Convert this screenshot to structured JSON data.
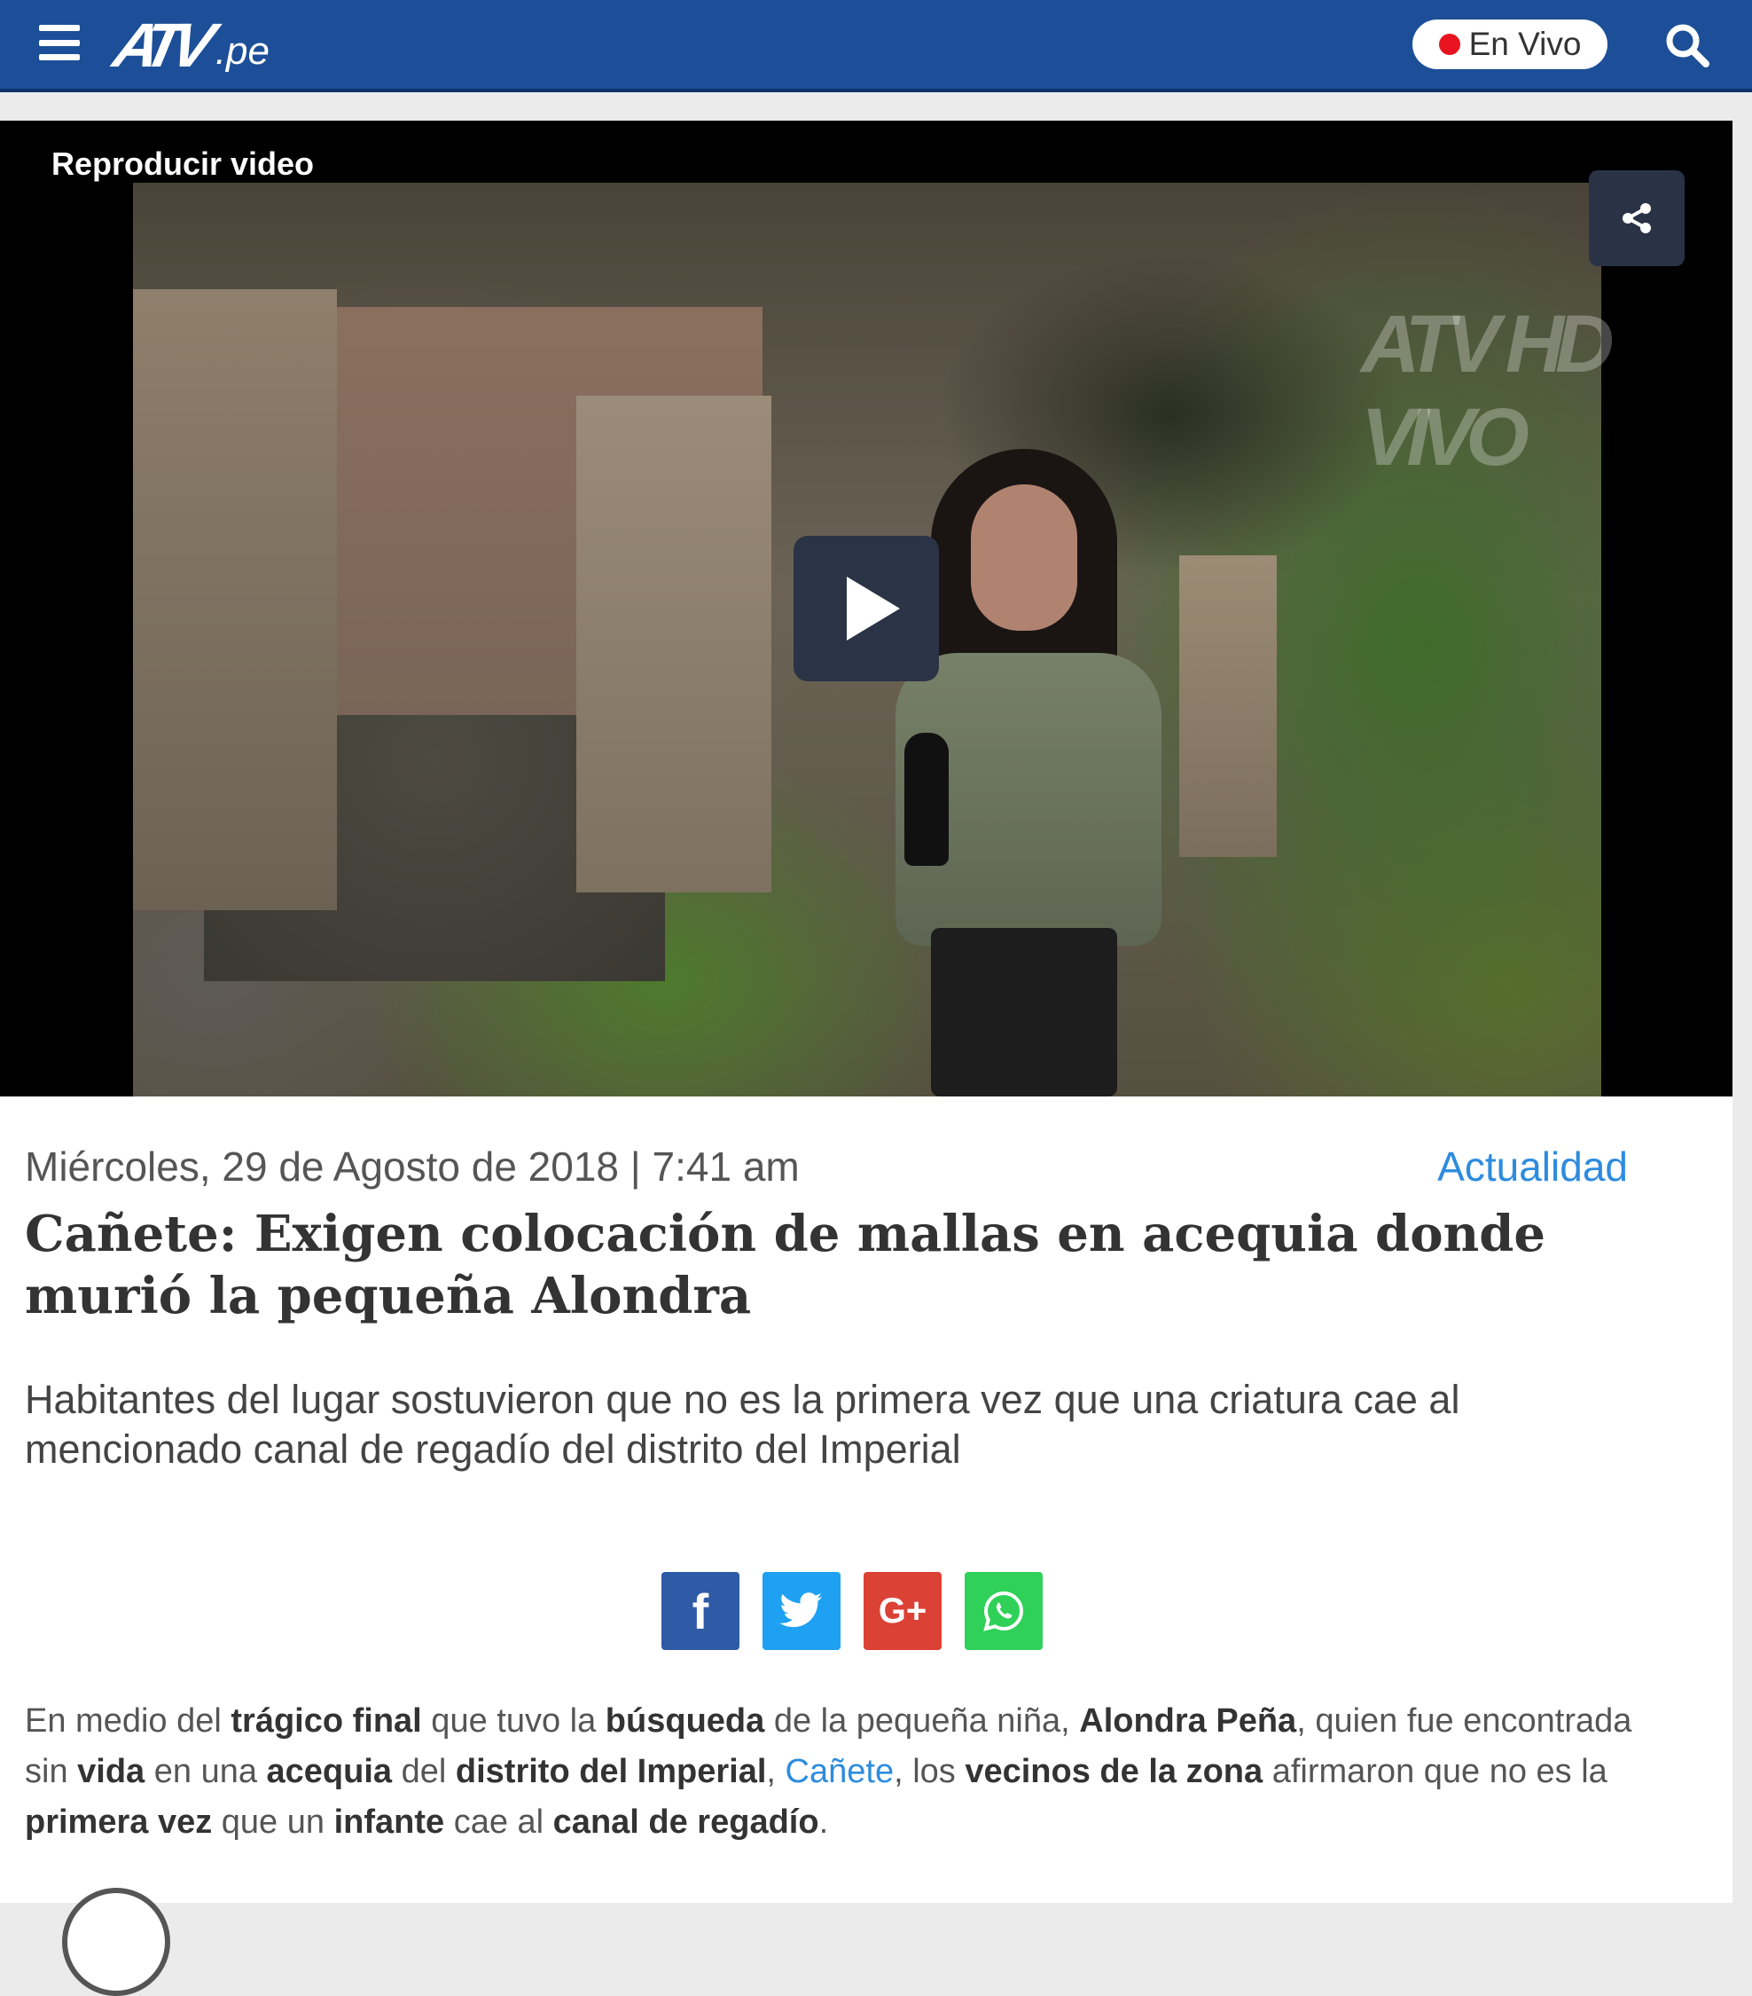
{
  "header": {
    "logo_mark": "ATV",
    "logo_suffix": ".pe",
    "live_label": "En Vivo",
    "menu_icon": "hamburger-icon",
    "search_icon": "search-icon",
    "brand_color": "#1c4f98",
    "live_color": "#e8131e"
  },
  "video": {
    "title": "Reproducir video",
    "watermark": "ATV HD VIVO",
    "share_icon": "share-icon",
    "play_icon": "play-icon"
  },
  "article": {
    "date": "Miércoles, 29 de Agosto de 2018 | 7:41 am",
    "category": "Actualidad",
    "headline": "Cañete: Exigen colocación de mallas en acequia donde murió la pequeña Alondra",
    "summary": "Habitantes del lugar sostuvieron que no es la primera vez que una criatura cae al mencionado canal de regadío del distrito del Imperial",
    "link_color": "#2d8cde"
  },
  "share": {
    "facebook": "f",
    "twitter_icon": "twitter-icon",
    "google_plus": "G+",
    "whatsapp_icon": "whatsapp-icon",
    "colors": [
      "#2f5ba6",
      "#1ea1f2",
      "#dc4135",
      "#2fd159"
    ]
  },
  "body": {
    "parts": [
      "En medio del ",
      "trágico final",
      " que tuvo la ",
      "búsqueda",
      " de la pequeña niña, ",
      "Alondra Peña",
      ", quien fue encontrada sin ",
      "vida",
      " en una ",
      "acequia",
      " del ",
      "distrito del Imperial",
      ", ",
      "Cañete",
      ", los ",
      "vecinos de la zona",
      " afirmaron que no es la ",
      "primera vez",
      " que un ",
      "infante",
      " cae al ",
      "canal de regadío",
      "."
    ]
  }
}
